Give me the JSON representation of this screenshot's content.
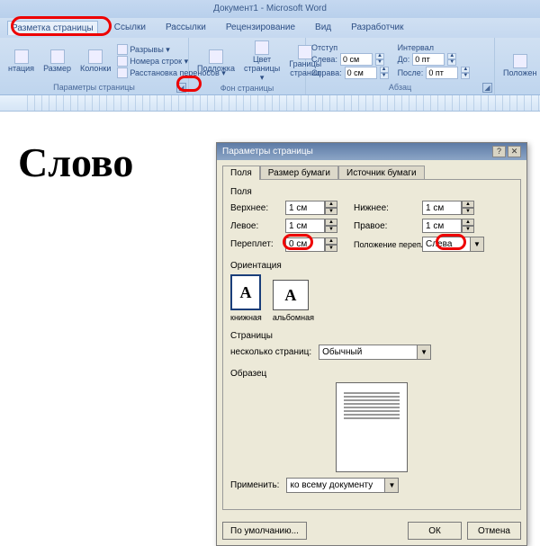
{
  "app": {
    "title": "Документ1 - Microsoft Word"
  },
  "tabs": {
    "items": [
      "Разметка страницы",
      "Ссылки",
      "Рассылки",
      "Рецензирование",
      "Вид",
      "Разработчик"
    ],
    "active_index": 0
  },
  "ribbon": {
    "group_page": {
      "label": "Параметры страницы",
      "orientation": "нтация",
      "size": "Размер",
      "columns": "Колонки",
      "breaks": "Разрывы ▾",
      "line_numbers": "Номера строк ▾",
      "hyphenation": "Расстановка переносов ▾"
    },
    "group_bg": {
      "label": "Фон страницы",
      "watermark": "Подложка",
      "color": "Цвет страницы ▾",
      "borders": "Границы страниц"
    },
    "group_para": {
      "label_indent": "Отступ",
      "label_spacing": "Интервал",
      "label_group": "Абзац",
      "left_label": "Слева:",
      "left_val": "0 см",
      "right_label": "Справа:",
      "right_val": "0 см",
      "before_label": "До:",
      "before_val": "0 пт",
      "after_label": "После:",
      "after_val": "0 пт"
    },
    "group_arrange": {
      "position": "Положен"
    }
  },
  "doc": {
    "text": "Слово"
  },
  "dialog": {
    "title": "Параметры страницы",
    "tabs": [
      "Поля",
      "Размер бумаги",
      "Источник бумаги"
    ],
    "fields": {
      "section": "Поля",
      "top_label": "Верхнее:",
      "top_val": "1 см",
      "bottom_label": "Нижнее:",
      "bottom_val": "1 см",
      "left_label": "Левое:",
      "left_val": "1 см",
      "right_label": "Правое:",
      "right_val": "1 см",
      "gutter_label": "Переплет:",
      "gutter_val": "0 см",
      "gutter_pos_label": "Положение переплета:",
      "gutter_pos_val": "Слева"
    },
    "orient": {
      "section": "Ориентация",
      "portrait": "книжная",
      "landscape": "альбомная"
    },
    "pages": {
      "section": "Страницы",
      "multi_label": "несколько страниц:",
      "multi_val": "Обычный"
    },
    "preview": {
      "section": "Образец",
      "apply_label": "Применить:",
      "apply_val": "ко всему документу"
    },
    "buttons": {
      "default": "По умолчанию...",
      "ok": "ОК",
      "cancel": "Отмена"
    }
  }
}
